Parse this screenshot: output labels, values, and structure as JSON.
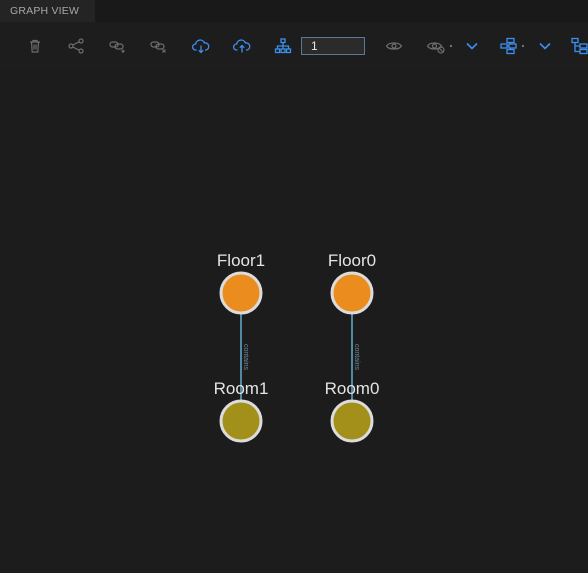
{
  "tab": {
    "title": "GRAPH VIEW"
  },
  "toolbar": {
    "level_value": "1",
    "icons": [
      "delete-icon",
      "share-graph-icon",
      "link-add-icon",
      "link-remove-icon",
      "cloud-download-icon",
      "cloud-upload-icon",
      "hierarchy-icon",
      "eye-icon",
      "eye-hide-icon",
      "layout-icon",
      "layout-tree-icon"
    ]
  },
  "graph": {
    "nodes": [
      {
        "id": "floor1",
        "label": "Floor1",
        "color": "#ea8c1e"
      },
      {
        "id": "floor0",
        "label": "Floor0",
        "color": "#ea8c1e"
      },
      {
        "id": "room1",
        "label": "Room1",
        "color": "#a3901b"
      },
      {
        "id": "room0",
        "label": "Room0",
        "color": "#a3901b"
      }
    ],
    "edges": [
      {
        "from": "floor1",
        "to": "room1",
        "label": "contains"
      },
      {
        "from": "floor0",
        "to": "room0",
        "label": "contains"
      }
    ]
  },
  "colors": {
    "background": "#1c1c1c",
    "toolbar_active": "#3d8ff0",
    "toolbar_inactive": "#6e6e6e",
    "edge": "#5fa6c8",
    "node_border": "#dcdcdc"
  }
}
